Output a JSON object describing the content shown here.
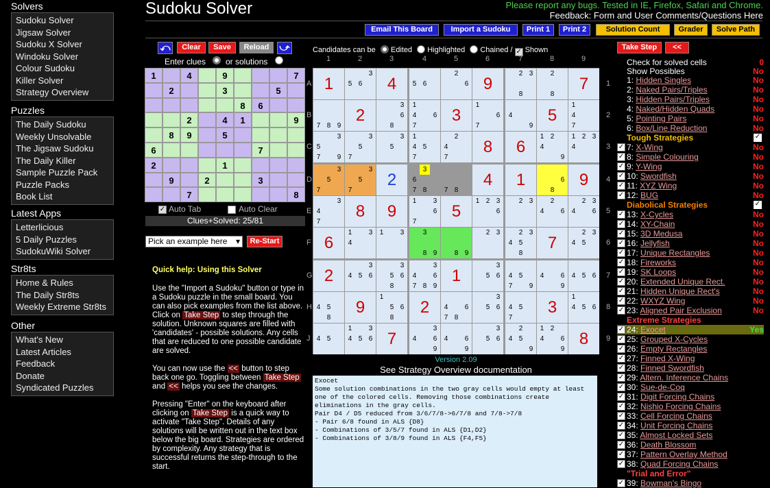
{
  "nav": {
    "sections": [
      {
        "title": "Solvers",
        "items": [
          "Sudoku Solver",
          "Jigsaw Solver",
          "Sudoku X Solver",
          "Windoku Solver",
          "Colour Sudoku",
          "Killer Solver",
          "Strategy Overview"
        ]
      },
      {
        "title": "Puzzles",
        "items": [
          "The Daily Sudoku",
          "Weekly Unsolvable",
          "The Jigsaw Sudoku",
          "The Daily Killer",
          "Sample Puzzle Pack",
          "Puzzle Packs",
          "Book List"
        ]
      },
      {
        "title": "Latest Apps",
        "items": [
          "Letterlicious",
          "5 Daily Puzzles",
          "SudokuWiki Solver"
        ]
      },
      {
        "title": "Str8ts",
        "items": [
          "Home & Rules",
          "The Daily Str8ts",
          "Weekly Extreme Str8ts"
        ]
      },
      {
        "title": "Other",
        "items": [
          "What's New",
          "Latest Articles",
          "Feedback",
          "Donate",
          "Syndicated Puzzles"
        ]
      }
    ]
  },
  "header": {
    "title": "Sudoku Solver",
    "report": "Please report any bugs. Tested in IE, Firefox, Safari and Chrome.",
    "feedback": "Feedback: Form and User Comments/Questions Here"
  },
  "toolbar": {
    "email": "Email This Board",
    "import": "Import a Sudoku",
    "print1": "Print 1",
    "print2": "Print 2",
    "solution_count": "Solution Count",
    "grader": "Grader",
    "solve_path": "Solve Path"
  },
  "controls": {
    "clear": "Clear",
    "save": "Save",
    "reload": "Reload",
    "enter_clues": "Enter clues",
    "or_solutions": "or solutions",
    "auto_tab": "Auto Tab",
    "auto_clear": "Auto Clear",
    "clues_solved": "Clues+Solved: 25/81",
    "example_select": "Pick an example here",
    "restart": "Re-Start",
    "take_step": "Take Step",
    "back": "<<"
  },
  "candidates_bar": {
    "label": "Candidates can be",
    "edited": "Edited",
    "highlighted": "Highlighted",
    "chained": "Chained /",
    "shown": "Shown"
  },
  "small_grid": [
    [
      "1",
      "",
      "4",
      "",
      "9",
      "",
      "",
      "",
      "7"
    ],
    [
      "",
      "2",
      "",
      "",
      "3",
      "",
      "",
      "5",
      ""
    ],
    [
      "",
      "",
      "",
      "",
      "",
      "8",
      "6",
      "",
      ""
    ],
    [
      "",
      "",
      "2",
      "",
      "4",
      "1",
      "",
      "",
      "9"
    ],
    [
      "",
      "8",
      "9",
      "",
      "5",
      "",
      "",
      "",
      ""
    ],
    [
      "6",
      "",
      "",
      "",
      "",
      "",
      "7",
      "",
      ""
    ],
    [
      "2",
      "",
      "",
      "",
      "1",
      "",
      "",
      "",
      ""
    ],
    [
      "",
      "9",
      "",
      "2",
      "",
      "",
      "3",
      "",
      ""
    ],
    [
      "",
      "",
      "7",
      "",
      "",
      "",
      "",
      "",
      "8"
    ]
  ],
  "board": [
    [
      {
        "v": "1"
      },
      {
        "c": [
          "3",
          "5",
          "6"
        ],
        "p": [
          2,
          3,
          4
        ]
      },
      {
        "v": "4"
      },
      {
        "c": [
          "5",
          "6"
        ],
        "p": [
          3,
          4
        ]
      },
      {
        "c": [
          "2",
          "6"
        ],
        "p": [
          1,
          5
        ]
      },
      {
        "v": "9"
      },
      {
        "c": [
          "2",
          "3",
          "8"
        ],
        "p": [
          1,
          2,
          7
        ]
      },
      {
        "c": [
          "2",
          "8"
        ],
        "p": [
          1,
          7
        ]
      },
      {
        "v": "7"
      }
    ],
    [
      {
        "c": [
          "7",
          "8",
          "9"
        ],
        "p": [
          6,
          7,
          8
        ]
      },
      {
        "v": "2"
      },
      {
        "c": [
          "3",
          "6",
          "8"
        ],
        "p": [
          2,
          5,
          7
        ]
      },
      {
        "c": [
          "1",
          "4",
          "6",
          "7"
        ],
        "p": [
          0,
          3,
          5,
          6
        ]
      },
      {
        "v": "3"
      },
      {
        "c": [
          "1",
          "6",
          "7"
        ],
        "p": [
          0,
          5,
          6
        ]
      },
      {
        "c": [
          "4",
          "9"
        ],
        "p": [
          3,
          8
        ]
      },
      {
        "v": "5"
      },
      {
        "c": [
          "1",
          "4",
          "7"
        ],
        "p": [
          0,
          3,
          6
        ]
      }
    ],
    [
      {
        "c": [
          "3",
          "5",
          "7",
          "9"
        ],
        "p": [
          2,
          3,
          6,
          8
        ]
      },
      {
        "c": [
          "3",
          "5",
          "7"
        ],
        "p": [
          2,
          4,
          6
        ]
      },
      {
        "c": [
          "3",
          "5"
        ],
        "p": [
          2,
          4
        ]
      },
      {
        "c": [
          "1",
          "4",
          "5",
          "7"
        ],
        "p": [
          0,
          3,
          4,
          6
        ]
      },
      {
        "c": [
          "2",
          "4",
          "7"
        ],
        "p": [
          1,
          3,
          6
        ]
      },
      {
        "v": "8"
      },
      {
        "v": "6"
      },
      {
        "c": [
          "1",
          "2",
          "4",
          "9"
        ],
        "p": [
          0,
          1,
          3,
          8
        ]
      },
      {
        "c": [
          "1",
          "2",
          "3",
          "4"
        ],
        "p": [
          0,
          1,
          2,
          3
        ]
      }
    ],
    [
      {
        "c": [
          "3",
          "5",
          "7"
        ],
        "p": [
          2,
          4,
          6
        ],
        "bg": "#f0a850"
      },
      {
        "c": [
          "3",
          "5",
          "7"
        ],
        "p": [
          2,
          4,
          6
        ],
        "bg": "#f0a850"
      },
      {
        "v": "2",
        "blue": true
      },
      {
        "c": [
          "3",
          "6",
          "7",
          "8"
        ],
        "p": [
          1,
          3,
          6,
          7
        ],
        "bg": "#999",
        "hl": 1
      },
      {
        "c": [
          "7",
          "8"
        ],
        "p": [
          6,
          7
        ],
        "bg": "#999"
      },
      {
        "v": "4"
      },
      {
        "v": "1"
      },
      {
        "c": [
          "6",
          "8"
        ],
        "p": [
          5,
          7
        ],
        "bg": "#ffff40"
      },
      {
        "v": "9"
      }
    ],
    [
      {
        "c": [
          "3",
          "4",
          "7"
        ],
        "p": [
          2,
          3,
          6
        ]
      },
      {
        "v": "8"
      },
      {
        "v": "9"
      },
      {
        "c": [
          "1",
          "3",
          "6",
          "7"
        ],
        "p": [
          0,
          2,
          5,
          6
        ]
      },
      {
        "v": "5"
      },
      {
        "c": [
          "1",
          "2",
          "3",
          "6"
        ],
        "p": [
          0,
          1,
          2,
          5
        ]
      },
      {
        "c": [
          "2",
          "3"
        ],
        "p": [
          1,
          2
        ]
      },
      {
        "c": [
          "2",
          "4",
          "6"
        ],
        "p": [
          1,
          3,
          5
        ]
      },
      {
        "c": [
          "2",
          "3",
          "4",
          "6"
        ],
        "p": [
          1,
          2,
          3,
          5
        ]
      }
    ],
    [
      {
        "v": "6"
      },
      {
        "c": [
          "1",
          "3",
          "4"
        ],
        "p": [
          0,
          2,
          3
        ]
      },
      {
        "c": [
          "1",
          "3"
        ],
        "p": [
          0,
          2
        ]
      },
      {
        "c": [
          "3",
          "8",
          "9"
        ],
        "p": [
          1,
          7,
          8
        ],
        "bg": "#66e85a"
      },
      {
        "c": [
          "8",
          "9"
        ],
        "p": [
          7,
          8
        ],
        "bg": "#66e85a"
      },
      {
        "c": [
          "2",
          "3"
        ],
        "p": [
          1,
          2
        ]
      },
      {
        "c": [
          "2",
          "3",
          "4",
          "5",
          "8"
        ],
        "p": [
          1,
          2,
          3,
          4,
          7
        ]
      },
      {
        "v": "7"
      },
      {
        "c": [
          "2",
          "3",
          "4",
          "5"
        ],
        "p": [
          1,
          2,
          3,
          4
        ]
      }
    ],
    [
      {
        "v": "2"
      },
      {
        "c": [
          "3",
          "4",
          "5",
          "6"
        ],
        "p": [
          2,
          3,
          4,
          5
        ]
      },
      {
        "c": [
          "3",
          "5",
          "6",
          "8"
        ],
        "p": [
          2,
          4,
          5,
          7
        ]
      },
      {
        "c": [
          "3",
          "4",
          "6",
          "7",
          "8",
          "9"
        ],
        "p": [
          2,
          3,
          5,
          6,
          7,
          8
        ]
      },
      {
        "v": "1"
      },
      {
        "c": [
          "3",
          "5",
          "6"
        ],
        "p": [
          2,
          4,
          5
        ]
      },
      {
        "c": [
          "4",
          "5",
          "7",
          "9"
        ],
        "p": [
          3,
          4,
          6,
          8
        ]
      },
      {
        "c": [
          "4",
          "6",
          "9"
        ],
        "p": [
          3,
          5,
          8
        ]
      },
      {
        "c": [
          "4",
          "5",
          "6"
        ],
        "p": [
          3,
          4,
          5
        ]
      }
    ],
    [
      {
        "c": [
          "4",
          "5",
          "8"
        ],
        "p": [
          3,
          4,
          7
        ]
      },
      {
        "v": "9"
      },
      {
        "c": [
          "1",
          "5",
          "6",
          "8"
        ],
        "p": [
          0,
          4,
          5,
          7
        ]
      },
      {
        "v": "2"
      },
      {
        "c": [
          "4",
          "6",
          "7",
          "8"
        ],
        "p": [
          3,
          5,
          6,
          7
        ]
      },
      {
        "c": [
          "3",
          "5",
          "6"
        ],
        "p": [
          2,
          4,
          5
        ]
      },
      {
        "c": [
          "4",
          "5",
          "7"
        ],
        "p": [
          3,
          4,
          6
        ]
      },
      {
        "v": "3"
      },
      {
        "c": [
          "1",
          "4",
          "5",
          "6"
        ],
        "p": [
          0,
          3,
          4,
          5
        ]
      }
    ],
    [
      {
        "c": [
          "4",
          "5"
        ],
        "p": [
          3,
          4
        ]
      },
      {
        "c": [
          "1",
          "3",
          "4",
          "5",
          "6"
        ],
        "p": [
          0,
          2,
          3,
          4,
          5
        ]
      },
      {
        "v": "7"
      },
      {
        "c": [
          "3",
          "4",
          "6",
          "9"
        ],
        "p": [
          2,
          3,
          5,
          8
        ]
      },
      {
        "c": [
          "4",
          "6",
          "9"
        ],
        "p": [
          3,
          5,
          8
        ]
      },
      {
        "c": [
          "3",
          "5",
          "6"
        ],
        "p": [
          2,
          4,
          5
        ]
      },
      {
        "c": [
          "2",
          "4",
          "5",
          "9"
        ],
        "p": [
          1,
          3,
          4,
          8
        ]
      },
      {
        "c": [
          "1",
          "2",
          "4",
          "6",
          "9"
        ],
        "p": [
          0,
          1,
          3,
          5,
          8
        ]
      },
      {
        "v": "8"
      }
    ]
  ],
  "axes": {
    "cols": [
      "1",
      "2",
      "3",
      "4",
      "5",
      "6",
      "7",
      "8",
      "9"
    ],
    "rows": [
      "A",
      "B",
      "C",
      "D",
      "E",
      "F",
      "G",
      "H",
      "J"
    ]
  },
  "version": "Version 2.09",
  "overview_link": "See Strategy Overview documentation",
  "message": "Exocet\nSome solution combinations in the two gray cells would empty at least one of the colored cells. Removing those combinations create eliminations in the gray cells.\nPair D4 / D5 reduced from 3/6/7/8->6/7/8 and 7/8->7/8\n- Pair 6/8 found in ALS {D8}\n- Combinations of 3/5/7 found in ALS {D1,D2}\n- Combinations of 3/8/9 found in ALS {F4,F5}",
  "help": {
    "title": "Quick help: Using this Solver",
    "p1": "Use the \"Import a Sudoku\" button or type in a Sudoku puzzle in the small board. You can also pick examples from the list above.",
    "p2a": "Click on",
    "p2b": "to step through the solution. Unknown squares are filled with 'candidates' - possible solutions. Any cells that are reduced to one possible candidate are solved.",
    "p3a": "You can now use the",
    "p3b": "button to step back one go. Toggling between",
    "p3c": "and",
    "p3d": "helps you see the changes.",
    "p4a": "Pressing \"Enter\" on the keyboard after clicking on",
    "p4b": "is a quick way to activate \"Take Step\". Details of any solutions will be written out in the text box below the big board. Strategies are ordered by complexity. Any strategy that is successful returns the step-through to the start."
  },
  "strategies": {
    "check_solved": "Check for solved cells",
    "check_solved_val": "0",
    "show_possibles": "Show Possibles",
    "show_possibles_val": "No",
    "basic": [
      {
        "n": "1:",
        "name": "Hidden Singles",
        "st": "No"
      },
      {
        "n": "2:",
        "name": "Naked Pairs/Triples",
        "st": "No"
      },
      {
        "n": "3:",
        "name": "Hidden Pairs/Triples",
        "st": "No"
      },
      {
        "n": "4:",
        "name": "Naked/Hidden Quads",
        "st": "No"
      },
      {
        "n": "5:",
        "name": "Pointing Pairs",
        "st": "No"
      },
      {
        "n": "6:",
        "name": "Box/Line Reduction",
        "st": "No"
      }
    ],
    "tough_title": "Tough Strategies",
    "tough": [
      {
        "n": "7:",
        "name": "X-Wing",
        "st": "No"
      },
      {
        "n": "8:",
        "name": "Simple Colouring",
        "st": "No"
      },
      {
        "n": "9:",
        "name": "Y-Wing",
        "st": "No"
      },
      {
        "n": "10:",
        "name": "Swordfish",
        "st": "No"
      },
      {
        "n": "11:",
        "name": "XYZ Wing",
        "st": "No"
      },
      {
        "n": "12:",
        "name": "BUG",
        "st": "No"
      }
    ],
    "diabolical_title": "Diabolical Strategies",
    "diabolical": [
      {
        "n": "13:",
        "name": "X-Cycles",
        "st": "No"
      },
      {
        "n": "14:",
        "name": "XY-Chain",
        "st": "No"
      },
      {
        "n": "15:",
        "name": "3D Medusa",
        "st": "No"
      },
      {
        "n": "16:",
        "name": "Jellyfish",
        "st": "No"
      },
      {
        "n": "17:",
        "name": "Unique Rectangles",
        "st": "No"
      },
      {
        "n": "18:",
        "name": "Fireworks",
        "st": "No"
      },
      {
        "n": "19:",
        "name": "SK Loops",
        "st": "No"
      },
      {
        "n": "20:",
        "name": "Extended Unique Rect.",
        "st": "No"
      },
      {
        "n": "21:",
        "name": "Hidden Unique Rect's",
        "st": "No"
      },
      {
        "n": "22:",
        "name": "WXYZ Wing",
        "st": "No"
      },
      {
        "n": "23:",
        "name": "Aligned Pair Exclusion",
        "st": "No"
      }
    ],
    "extreme_title": "Extreme Strategies",
    "extreme": [
      {
        "n": "24:",
        "name": "Exocet",
        "st": "Yes"
      },
      {
        "n": "25:",
        "name": "Grouped X-Cycles",
        "st": ""
      },
      {
        "n": "26:",
        "name": "Empty Rectangles",
        "st": ""
      },
      {
        "n": "27:",
        "name": "Finned X-Wing",
        "st": ""
      },
      {
        "n": "28:",
        "name": "Finned Swordfish",
        "st": ""
      },
      {
        "n": "29:",
        "name": "Altern. Inference Chains",
        "st": ""
      },
      {
        "n": "30:",
        "name": "Sue-de-Coq",
        "st": ""
      },
      {
        "n": "31:",
        "name": "Digit Forcing Chains",
        "st": ""
      },
      {
        "n": "32:",
        "name": "Nishio Forcing Chains",
        "st": ""
      },
      {
        "n": "33:",
        "name": "Cell Forcing Chains",
        "st": ""
      },
      {
        "n": "34:",
        "name": "Unit Forcing Chains",
        "st": ""
      },
      {
        "n": "35:",
        "name": "Almost Locked Sets",
        "st": ""
      },
      {
        "n": "36:",
        "name": "Death Blossom",
        "st": ""
      },
      {
        "n": "37:",
        "name": "Pattern Overlay Method",
        "st": ""
      },
      {
        "n": "38:",
        "name": "Quad Forcing Chains",
        "st": ""
      }
    ],
    "trial_title": "\"Trial and Error\"",
    "trial": [
      {
        "n": "39:",
        "name": "Bowman's Bingo",
        "st": ""
      }
    ]
  }
}
